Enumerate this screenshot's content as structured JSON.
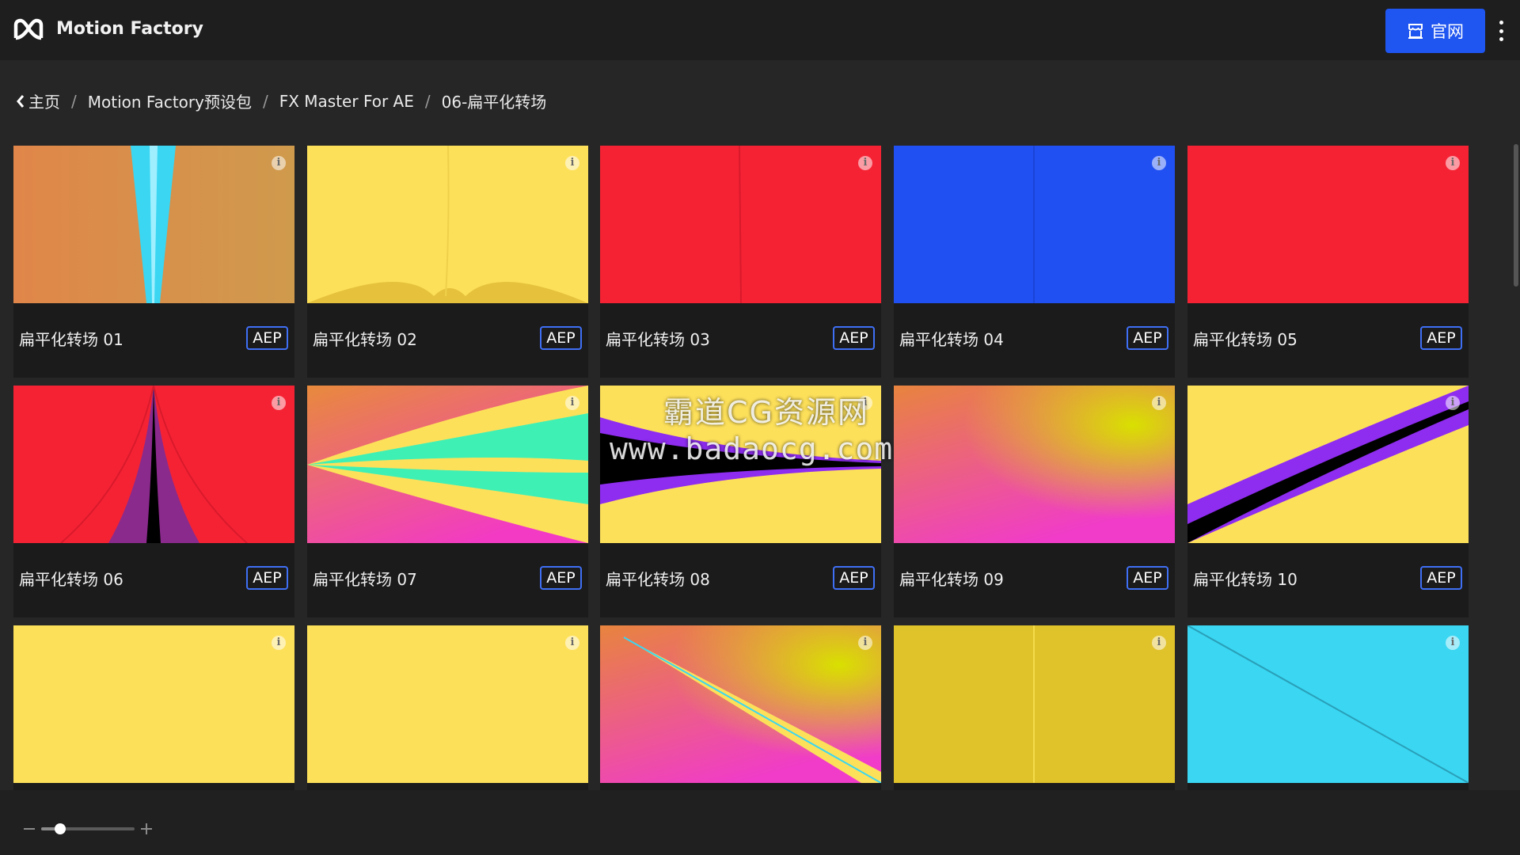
{
  "header": {
    "app_title": "Motion Factory",
    "site_button_label": "官网",
    "accent_color": "#1f55f0"
  },
  "breadcrumb": {
    "items": [
      "主页",
      "Motion Factory预设包",
      "FX Master For AE",
      "06-扁平化转场"
    ]
  },
  "cards": [
    {
      "title": "扁平化转场 01",
      "badge": "AEP"
    },
    {
      "title": "扁平化转场 02",
      "badge": "AEP"
    },
    {
      "title": "扁平化转场 03",
      "badge": "AEP"
    },
    {
      "title": "扁平化转场 04",
      "badge": "AEP"
    },
    {
      "title": "扁平化转场 05",
      "badge": "AEP"
    },
    {
      "title": "扁平化转场 06",
      "badge": "AEP"
    },
    {
      "title": "扁平化转场 07",
      "badge": "AEP"
    },
    {
      "title": "扁平化转场 08",
      "badge": "AEP"
    },
    {
      "title": "扁平化转场 09",
      "badge": "AEP"
    },
    {
      "title": "扁平化转场 10",
      "badge": "AEP"
    },
    {
      "title": "",
      "badge": ""
    },
    {
      "title": "",
      "badge": ""
    },
    {
      "title": "",
      "badge": ""
    },
    {
      "title": "",
      "badge": ""
    },
    {
      "title": "",
      "badge": ""
    }
  ],
  "zoom": {
    "level": 0.2
  },
  "watermark": {
    "line1": "霸道CG资源网",
    "line2": "www.badaocg.com"
  },
  "icons": {
    "info": "i"
  }
}
